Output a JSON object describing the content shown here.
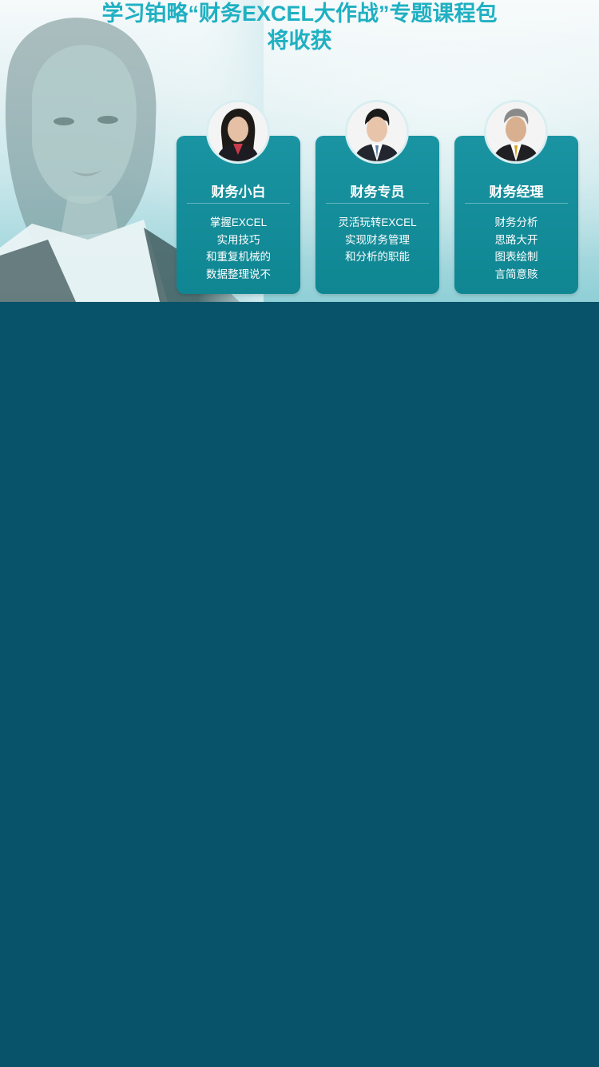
{
  "header": {
    "title_line1": "学习铂略“财务EXCEL大作战”专题课程包",
    "title_line2": "将收获"
  },
  "cards": [
    {
      "title": "财务小白",
      "avatar": "female-professional-avatar",
      "lines": [
        "掌握EXCEL",
        "实用技巧",
        "和重复机械的",
        "数据整理说不"
      ]
    },
    {
      "title": "财务专员",
      "avatar": "young-male-professional-avatar",
      "lines": [
        "灵活玩转EXCEL",
        "实现财务管理",
        "和分析的职能"
      ]
    },
    {
      "title": "财务经理",
      "avatar": "senior-male-professional-avatar",
      "lines": [
        "财务分析",
        "思路大开",
        "图表绘制",
        "言简意赅"
      ]
    }
  ],
  "colors": {
    "title": "#1fb0c2",
    "card": "#13909c",
    "page_background": "#08526a"
  }
}
